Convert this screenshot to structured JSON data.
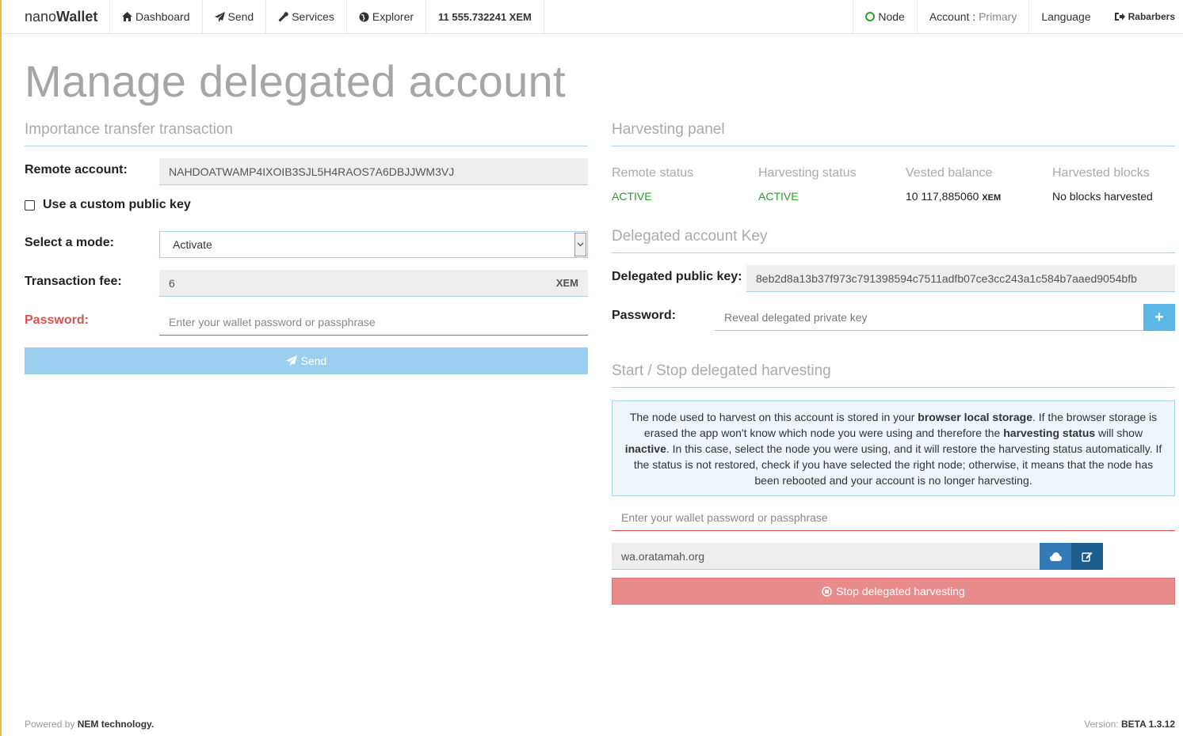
{
  "navbar": {
    "brand_prefix": "nano",
    "brand_suffix": "Wallet",
    "dashboard": "Dashboard",
    "send": "Send",
    "services": "Services",
    "explorer": "Explorer",
    "balance": "11 555.732241 XEM",
    "node": "Node",
    "account_label": "Account :",
    "account_name": "Primary",
    "language": "Language",
    "user": "Rabarbers"
  },
  "page": {
    "title": "Manage delegated account"
  },
  "importance": {
    "section_title": "Importance transfer transaction",
    "remote_account_label": "Remote account:",
    "remote_account_value": "NAHDOATWAMP4IXOIB3SJL5H4RAOS7A6DBJJWM3VJ",
    "custom_key_label": "Use a custom public key",
    "mode_label": "Select a mode:",
    "mode_value": "Activate",
    "fee_label": "Transaction fee:",
    "fee_value": "6",
    "fee_unit": "XEM",
    "password_label": "Password:",
    "password_placeholder": "Enter your wallet password or passphrase",
    "send_label": "Send"
  },
  "harvesting": {
    "section_title": "Harvesting panel",
    "remote_status_head": "Remote status",
    "remote_status_value": "ACTIVE",
    "harvesting_status_head": "Harvesting status",
    "harvesting_status_value": "ACTIVE",
    "vested_head": "Vested balance",
    "vested_value": "10 117,885060",
    "vested_unit": "XEM",
    "blocks_head": "Harvested blocks",
    "blocks_value": "No blocks harvested"
  },
  "delegated_key": {
    "section_title": "Delegated account Key",
    "public_key_label": "Delegated public key:",
    "public_key_value": "8eb2d8a13b37f973c791398594c7511adfb07ce3cc243a1c584b7aaed9054bfb",
    "password_label": "Password:",
    "password_placeholder": "Reveal delegated private key",
    "plus_label": "+"
  },
  "startstop": {
    "section_title": "Start / Stop delegated harvesting",
    "info_1": "The node used to harvest on this account is stored in your ",
    "info_b1": "browser local storage",
    "info_2": ". If the browser storage is erased the app won't know which node you were using and therefore the ",
    "info_b2": "harvesting status",
    "info_3": " will show ",
    "info_b3": "inactive",
    "info_4": ". In this case, select the node you were using, and it will restore the harvesting status automatically. If the status is not restored, check if you have selected the right node; otherwise, it means that the node has been rebooted and your account is no longer harvesting.",
    "password_placeholder": "Enter your wallet password or passphrase",
    "node_value": "wa.oratamah.org",
    "stop_label": "Stop delegated harvesting"
  },
  "footer": {
    "powered_prefix": "Powered by",
    "powered_name": "NEM technology.",
    "version_label": "Version:",
    "version_value": "BETA 1.3.12"
  },
  "colors": {
    "accent_blue": "#a8d4e8",
    "active_green": "#2c9c2c",
    "error_red": "#d9534f",
    "send_button": "#9ccfef",
    "stop_button": "#e98b8b"
  }
}
